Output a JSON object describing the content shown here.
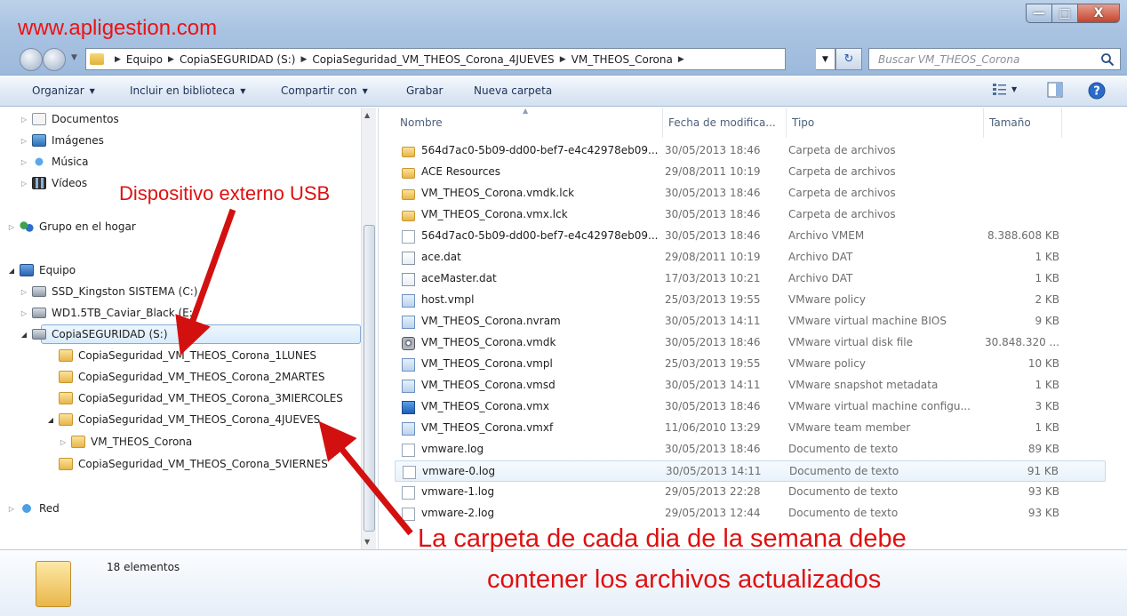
{
  "watermark": "www.apligestion.com",
  "window_buttons": {
    "minimize": "—",
    "maximize": "□",
    "close": "X"
  },
  "address": {
    "crumbs": [
      "Equipo",
      "CopiaSEGURIDAD (S:)",
      "CopiaSeguridad_VM_THEOS_Corona_4JUEVES",
      "VM_THEOS_Corona"
    ],
    "search_placeholder": "Buscar VM_THEOS_Corona"
  },
  "toolbar": {
    "organize": "Organizar",
    "include": "Incluir en biblioteca",
    "share": "Compartir con",
    "burn": "Grabar",
    "new_folder": "Nueva carpeta"
  },
  "nav": {
    "documents": "Documentos",
    "images": "Imágenes",
    "music": "Música",
    "videos": "Vídeos",
    "homegroup": "Grupo en el hogar",
    "computer": "Equipo",
    "ssd": "SSD_Kingston SISTEMA (C:)",
    "wd": "WD1.5TB_Caviar_Black (E:)",
    "copia": "CopiaSEGURIDAD (S:)",
    "f1": "CopiaSeguridad_VM_THEOS_Corona_1LUNES",
    "f2": "CopiaSeguridad_VM_THEOS_Corona_2MARTES",
    "f3": "CopiaSeguridad_VM_THEOS_Corona_3MIERCOLES",
    "f4": "CopiaSeguridad_VM_THEOS_Corona_4JUEVES",
    "selected": "VM_THEOS_Corona",
    "f5": "CopiaSeguridad_VM_THEOS_Corona_5VIERNES",
    "network": "Red"
  },
  "columns": {
    "name": "Nombre",
    "date": "Fecha de modifica...",
    "type": "Tipo",
    "size": "Tamaño"
  },
  "files": [
    {
      "name": "564d7ac0-5b09-dd00-bef7-e4c42978eb09...",
      "date": "30/05/2013 18:46",
      "type": "Carpeta de archivos",
      "size": ""
    },
    {
      "name": "ACE Resources",
      "date": "29/08/2011 10:19",
      "type": "Carpeta de archivos",
      "size": ""
    },
    {
      "name": "VM_THEOS_Corona.vmdk.lck",
      "date": "30/05/2013 18:46",
      "type": "Carpeta de archivos",
      "size": ""
    },
    {
      "name": "VM_THEOS_Corona.vmx.lck",
      "date": "30/05/2013 18:46",
      "type": "Carpeta de archivos",
      "size": ""
    },
    {
      "name": "564d7ac0-5b09-dd00-bef7-e4c42978eb09...",
      "date": "30/05/2013 18:46",
      "type": "Archivo VMEM",
      "size": "8.388.608 KB"
    },
    {
      "name": "ace.dat",
      "date": "29/08/2011 10:19",
      "type": "Archivo DAT",
      "size": "1 KB"
    },
    {
      "name": "aceMaster.dat",
      "date": "17/03/2013 10:21",
      "type": "Archivo DAT",
      "size": "1 KB"
    },
    {
      "name": "host.vmpl",
      "date": "25/03/2013 19:55",
      "type": "VMware policy",
      "size": "2 KB"
    },
    {
      "name": "VM_THEOS_Corona.nvram",
      "date": "30/05/2013 14:11",
      "type": "VMware virtual machine BIOS",
      "size": "9 KB"
    },
    {
      "name": "VM_THEOS_Corona.vmdk",
      "date": "30/05/2013 18:46",
      "type": "VMware virtual disk file",
      "size": "30.848.320 ..."
    },
    {
      "name": "VM_THEOS_Corona.vmpl",
      "date": "25/03/2013 19:55",
      "type": "VMware policy",
      "size": "10 KB"
    },
    {
      "name": "VM_THEOS_Corona.vmsd",
      "date": "30/05/2013 14:11",
      "type": "VMware snapshot metadata",
      "size": "1 KB"
    },
    {
      "name": "VM_THEOS_Corona.vmx",
      "date": "30/05/2013 18:46",
      "type": "VMware virtual machine configu...",
      "size": "3 KB"
    },
    {
      "name": "VM_THEOS_Corona.vmxf",
      "date": "11/06/2010 13:29",
      "type": "VMware team member",
      "size": "1 KB"
    },
    {
      "name": "vmware.log",
      "date": "30/05/2013 18:46",
      "type": "Documento de texto",
      "size": "89 KB"
    },
    {
      "name": "vmware-0.log",
      "date": "30/05/2013 14:11",
      "type": "Documento de texto",
      "size": "91 KB"
    },
    {
      "name": "vmware-1.log",
      "date": "29/05/2013 22:28",
      "type": "Documento de texto",
      "size": "93 KB"
    },
    {
      "name": "vmware-2.log",
      "date": "29/05/2013 12:44",
      "type": "Documento de texto",
      "size": "93 KB"
    }
  ],
  "status": {
    "count": "18 elementos"
  },
  "annotations": {
    "usb": "Dispositivo externo USB",
    "line1": "La carpeta de cada dia de la semana debe",
    "line2": "contener los archivos actualizados"
  },
  "colors": {
    "annotation": "#e01010",
    "selection_border": "#84acd8"
  }
}
